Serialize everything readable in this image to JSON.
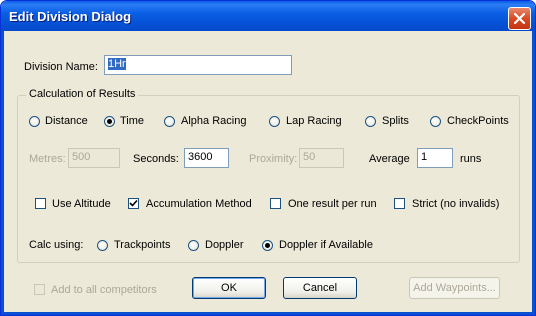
{
  "window": {
    "title": "Edit Division Dialog"
  },
  "division": {
    "name_label": "Division Name:",
    "name_value": "1Hr"
  },
  "calculation": {
    "group_title": "Calculation of Results",
    "modes": [
      {
        "label": "Distance",
        "selected": false
      },
      {
        "label": "Time",
        "selected": true
      },
      {
        "label": "Alpha Racing",
        "selected": false
      },
      {
        "label": "Lap Racing",
        "selected": false
      },
      {
        "label": "Splits",
        "selected": false
      },
      {
        "label": "CheckPoints",
        "selected": false
      }
    ],
    "metres": {
      "label": "Metres:",
      "value": "500",
      "enabled": false
    },
    "seconds": {
      "label": "Seconds:",
      "value": "3600",
      "enabled": true
    },
    "proximity": {
      "label": "Proximity:",
      "value": "50",
      "enabled": false
    },
    "average": {
      "label": "Average",
      "value": "1",
      "unit": "runs"
    },
    "options": [
      {
        "label": "Use Altitude",
        "checked": false
      },
      {
        "label": "Accumulation Method",
        "checked": true
      },
      {
        "label": "One result per run",
        "checked": false
      },
      {
        "label": "Strict (no invalids)",
        "checked": false
      }
    ],
    "calc_using": {
      "label": "Calc using:",
      "choices": [
        {
          "label": "Trackpoints",
          "selected": false
        },
        {
          "label": "Doppler",
          "selected": false
        },
        {
          "label": "Doppler if Available",
          "selected": true
        }
      ]
    }
  },
  "footer": {
    "add_all_label": "Add to all competitors",
    "ok_label": "OK",
    "cancel_label": "Cancel",
    "add_waypoints_label": "Add Waypoints..."
  },
  "colors": {
    "titlebar": "#0a5fe4",
    "dialog_bg": "#ece9d8",
    "selected_radio": "#21a121",
    "selection": "#316ac5"
  }
}
